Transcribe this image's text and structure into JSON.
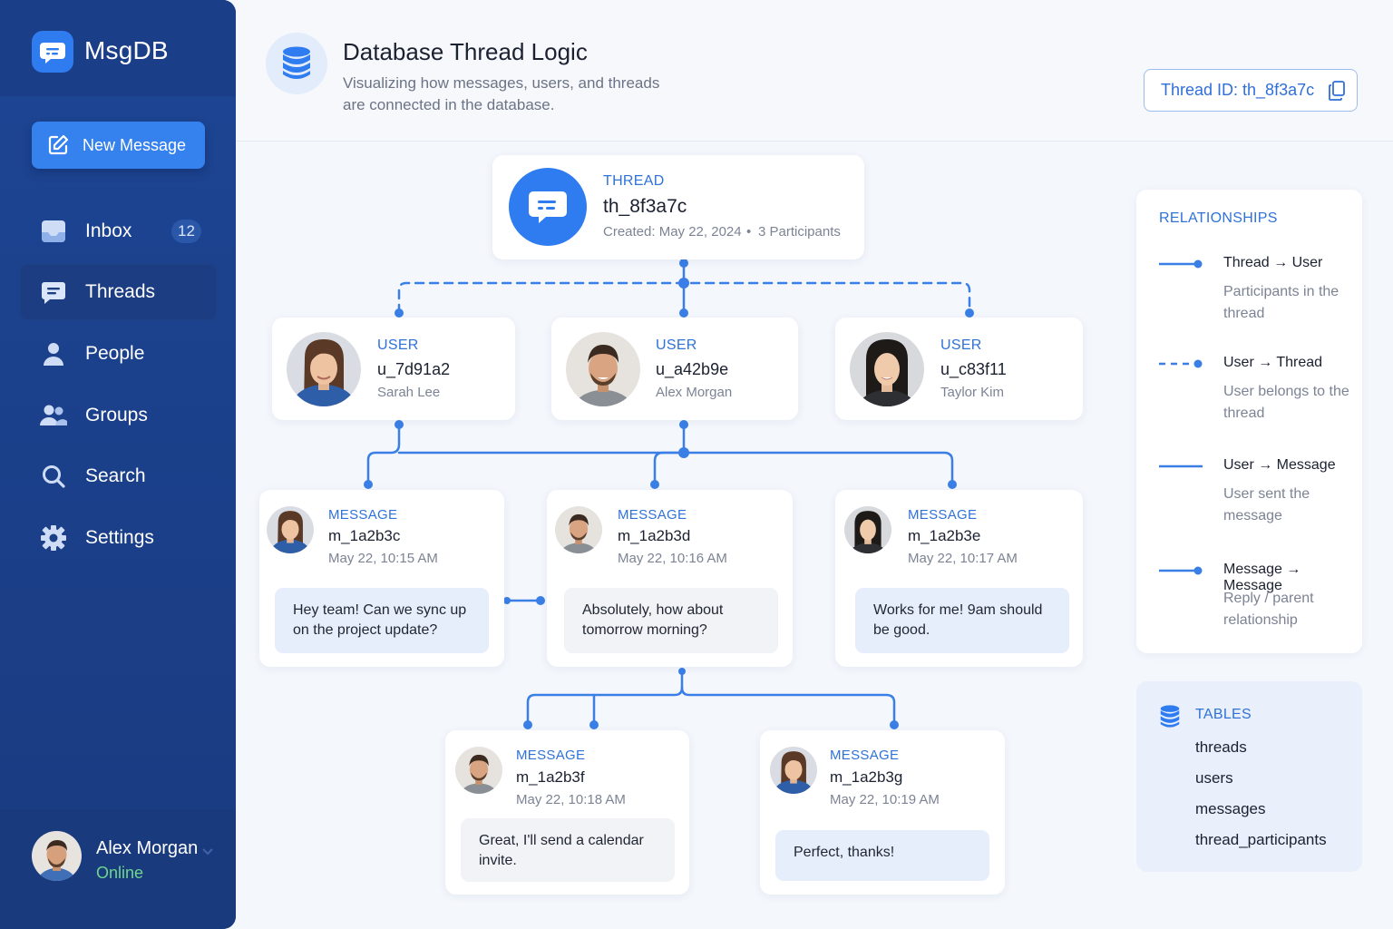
{
  "app": {
    "name": "MsgDB"
  },
  "sidebar": {
    "new_message": "New Message",
    "items": [
      {
        "label": "Inbox",
        "badge": "12"
      },
      {
        "label": "Threads"
      },
      {
        "label": "People"
      },
      {
        "label": "Groups"
      },
      {
        "label": "Search"
      },
      {
        "label": "Settings"
      }
    ],
    "active": "Threads"
  },
  "profile": {
    "name": "Alex Morgan",
    "status": "Online"
  },
  "header": {
    "title": "Database Thread Logic",
    "subtitle": "Visualizing how messages, users, and threads are connected in the database.",
    "thread_id_button": "Thread ID: th_8f3a7c"
  },
  "thread": {
    "label": "THREAD",
    "id": "th_8f3a7c",
    "created": "Created: May 22, 2024",
    "separator": "•",
    "participants": "3 Participants"
  },
  "users": [
    {
      "label": "USER",
      "id": "u_7d91a2",
      "name": "Sarah Lee"
    },
    {
      "label": "USER",
      "id": "u_a42b9e",
      "name": "Alex Morgan"
    },
    {
      "label": "USER",
      "id": "u_c83f11",
      "name": "Taylor Kim"
    }
  ],
  "messages": [
    {
      "label": "MESSAGE",
      "id": "m_1a2b3c",
      "time": "May 22, 10:15 AM",
      "text": "Hey team! Can we sync up on the project update?"
    },
    {
      "label": "MESSAGE",
      "id": "m_1a2b3d",
      "time": "May 22, 10:16 AM",
      "text": "Absolutely, how about tomorrow morning?"
    },
    {
      "label": "MESSAGE",
      "id": "m_1a2b3e",
      "time": "May 22, 10:17 AM",
      "text": "Works for me! 9am should be good."
    },
    {
      "label": "MESSAGE",
      "id": "m_1a2b3f",
      "time": "May 22, 10:18 AM",
      "text": "Great, I'll send a calendar invite."
    },
    {
      "label": "MESSAGE",
      "id": "m_1a2b3g",
      "time": "May 22, 10:19 AM",
      "text": "Perfect, thanks!"
    }
  ],
  "relationships": {
    "title": "RELATIONSHIPS",
    "items": [
      {
        "name": "Thread → User",
        "desc": "Participants in the thread",
        "style": "solid-dot"
      },
      {
        "name": "User → Thread",
        "desc": "User belongs to the thread",
        "style": "dashed-dot"
      },
      {
        "name": "User → Message",
        "desc": "User sent the message",
        "style": "solid"
      },
      {
        "name": "Message → Message",
        "desc": "Reply / parent relationship",
        "style": "solid-dot"
      }
    ]
  },
  "tables": {
    "title": "TABLES",
    "items": [
      "threads",
      "users",
      "messages",
      "thread_participants"
    ]
  },
  "colors": {
    "accent": "#2f7bf0",
    "sidebar": "#1d4694",
    "line": "#3a7fe6",
    "online": "#6fd68d"
  }
}
